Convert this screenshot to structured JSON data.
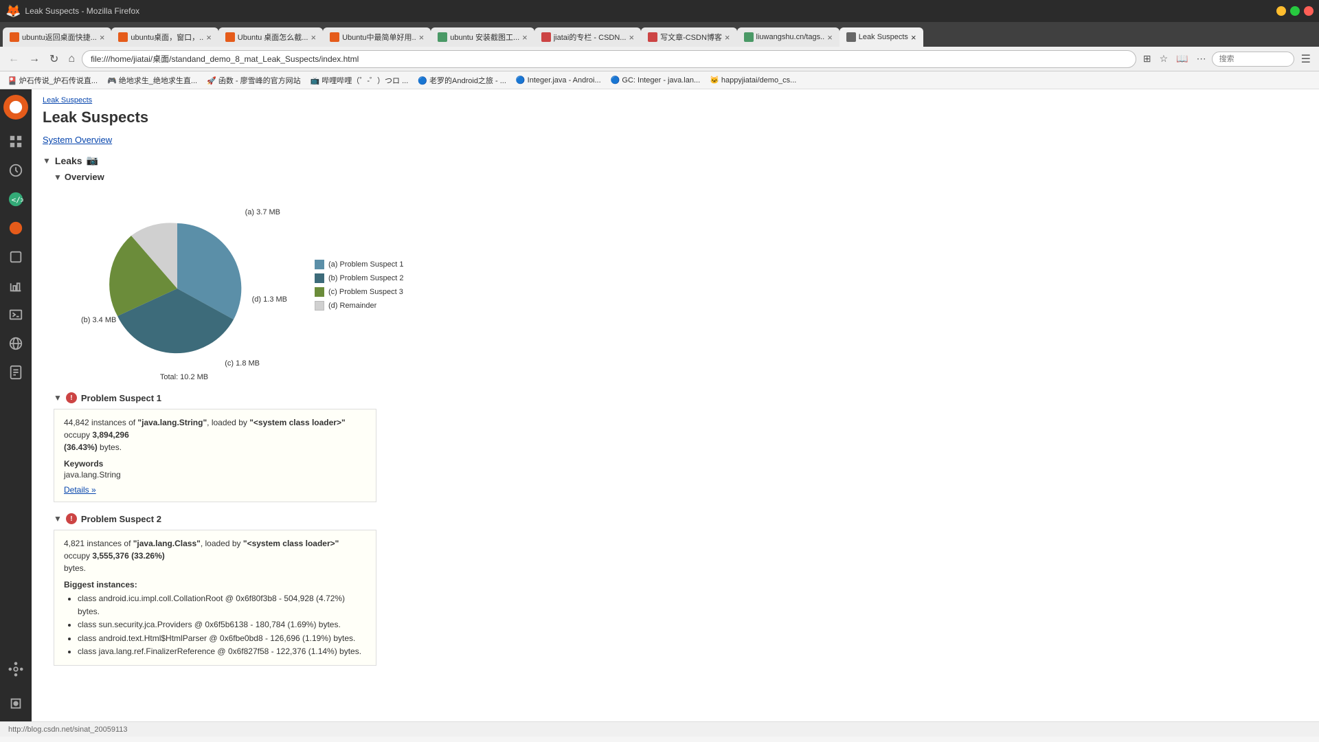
{
  "window": {
    "title": "Leak Suspects - Mozilla Firefox"
  },
  "tabs": [
    {
      "id": "tab1",
      "label": "ubuntu返回桌面快捷...",
      "favicon_color": "#e55b1a",
      "active": false
    },
    {
      "id": "tab2",
      "label": "ubuntu桌面，窗口，..",
      "favicon_color": "#e55b1a",
      "active": false
    },
    {
      "id": "tab3",
      "label": "Ubuntu 桌面怎么截...",
      "favicon_color": "#e55b1a",
      "active": false
    },
    {
      "id": "tab4",
      "label": "Ubuntu中最简单好用..",
      "favicon_color": "#e55b1a",
      "active": false
    },
    {
      "id": "tab5",
      "label": "ubuntu 安装截图工...",
      "favicon_color": "#4a9",
      "active": false
    },
    {
      "id": "tab6",
      "label": "jiatai的专栏 - CSDN...",
      "favicon_color": "#c44",
      "active": false
    },
    {
      "id": "tab7",
      "label": "写文章-CSDN博客",
      "favicon_color": "#c44",
      "active": false
    },
    {
      "id": "tab8",
      "label": "liuwangshu.cn/tags..",
      "favicon_color": "#4a9",
      "active": false
    },
    {
      "id": "tab9",
      "label": "Leak Suspects",
      "favicon_color": "#666",
      "active": true
    }
  ],
  "nav": {
    "url": "file:///home/jiatai/桌面/standand_demo_8_mat_Leak_Suspects/index.html",
    "search_placeholder": "搜索"
  },
  "bookmarks": [
    "炉石传说_炉石传说直...",
    "绝地求生_绝地求生直...",
    "函数 - 廖雪峰的官方网站",
    "哔哩哔哩（゜-゜）つロ ...",
    "老罗的Android之旅 - ...",
    "Integer.java - Androi...",
    "GC: Integer - java.lan...",
    "happyjiatai/demo_cs..."
  ],
  "breadcrumb": "Leak Suspects",
  "page_title": "Leak Suspects",
  "system_overview_link": "System Overview",
  "leaks_section": {
    "toggle": "▼",
    "title": "Leaks",
    "overview": {
      "toggle": "▼",
      "title": "Overview",
      "chart": {
        "slices": [
          {
            "id": "a",
            "label": "(a) 3.7 MB",
            "value": 36.43,
            "color": "#5b8fa8",
            "legend": "Problem Suspect 1"
          },
          {
            "id": "b",
            "label": "(b) 3.4 MB",
            "value": 33.26,
            "color": "#3d6b7a",
            "legend": "Problem Suspect 2"
          },
          {
            "id": "c",
            "label": "(c) 1.8 MB",
            "value": 17.6,
            "color": "#6b8c3a",
            "legend": "Problem Suspect 3"
          },
          {
            "id": "d",
            "label": "(d) 1.3 MB",
            "value": 12.7,
            "color": "#d0d0d0",
            "legend": "Remainder"
          }
        ],
        "total": "Total: 10.2 MB"
      }
    }
  },
  "problem_suspect_1": {
    "toggle": "▼",
    "title": "Problem Suspect 1",
    "description_prefix": "44,842 instances of ",
    "class_name": "\"java.lang.String\"",
    "description_mid": ", loaded by ",
    "loader": "\"<system class loader>\"",
    "description_suffix": " occupy ",
    "bytes": "3,894,296",
    "percent": "(36.43%)",
    "description_end": " bytes.",
    "keywords_label": "Keywords",
    "keywords_value": "java.lang.String",
    "details_link": "Details »"
  },
  "problem_suspect_2": {
    "toggle": "▼",
    "title": "Problem Suspect 2",
    "description_prefix": "4,821 instances of ",
    "class_name": "\"java.lang.Class\"",
    "description_mid": ", loaded by ",
    "loader": "\"<system class loader>\"",
    "description_suffix": " occupy ",
    "bytes": "3,555,376 (33.26%)",
    "description_end": " bytes.",
    "biggest_instances_label": "Biggest instances:",
    "instances": [
      "class android.icu.impl.coll.CollationRoot @ 0x6f80f3b8 - 504,928 (4.72%) bytes.",
      "class sun.security.jca.Providers @ 0x6f5b6138 - 180,784 (1.69%) bytes.",
      "class android.text.Html$HtmlParser @ 0x6fbe0bd8 - 126,696 (1.19%) bytes.",
      "class java.lang.ref.FinalizerReference @ 0x6f827f58 - 122,376 (1.14%) bytes."
    ]
  },
  "status_bar": {
    "url": "http://blog.csdn.net/sinat_20059113"
  },
  "colors": {
    "accent_blue": "#0645ad",
    "problem_red": "#cc4444",
    "pie_a": "#5b8fa8",
    "pie_b": "#3d6b7a",
    "pie_c": "#6b8c3a",
    "pie_d": "#d0d0d0"
  }
}
